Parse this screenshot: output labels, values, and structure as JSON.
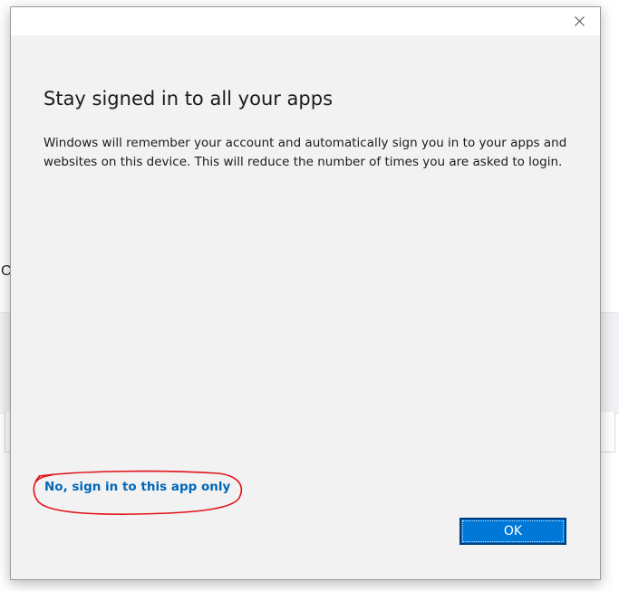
{
  "background": {
    "partial_letter": "C"
  },
  "dialog": {
    "title": "Stay signed in to all your apps",
    "body": "Windows will remember your account and automatically sign you in to your apps and websites on this device. This will reduce the number of times you are asked to login.",
    "alt_link": "No, sign in to this app only",
    "ok_label": "OK",
    "close_icon": "close-icon",
    "annotation_color": "#e0131a",
    "accent_color": "#0078d7",
    "link_color": "#0067b8"
  }
}
